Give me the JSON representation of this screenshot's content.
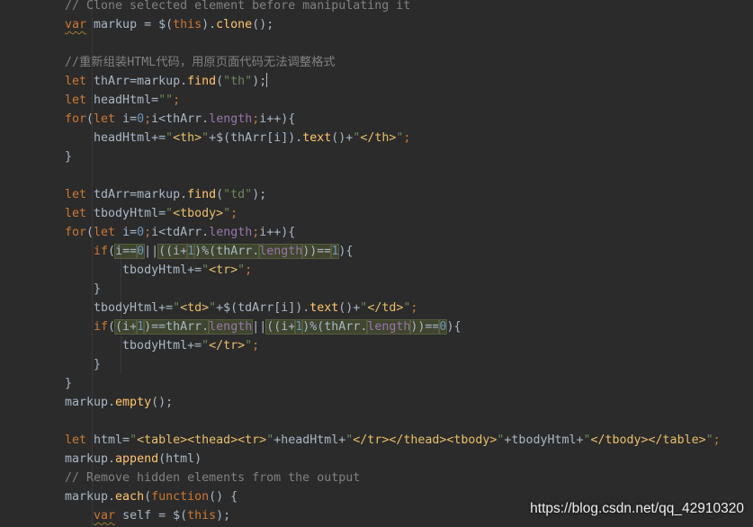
{
  "editor": {
    "lines": [
      {
        "indent": 0,
        "tokens": [
          {
            "t": "// Clone selected element before manipulating it",
            "c": "cm"
          }
        ]
      },
      {
        "indent": 0,
        "tokens": [
          {
            "t": "var",
            "c": "kw",
            "wavy": true
          },
          {
            "t": " markup = $(",
            "c": "plain"
          },
          {
            "t": "this",
            "c": "this"
          },
          {
            "t": ").",
            "c": "plain"
          },
          {
            "t": "clone",
            "c": "fn"
          },
          {
            "t": "();",
            "c": "plain"
          }
        ]
      },
      {
        "indent": 0,
        "tokens": []
      },
      {
        "indent": 0,
        "tokens": [
          {
            "t": "//重新组装HTML代码，用原页面代码无法调整格式",
            "c": "cm"
          }
        ]
      },
      {
        "indent": 0,
        "caret": true,
        "tokens": [
          {
            "t": "let",
            "c": "kw"
          },
          {
            "t": " thArr=markup.",
            "c": "plain"
          },
          {
            "t": "find",
            "c": "fn"
          },
          {
            "t": "(",
            "c": "plain"
          },
          {
            "t": "\"th\"",
            "c": "str"
          },
          {
            "t": ");",
            "c": "plain"
          }
        ]
      },
      {
        "indent": 0,
        "tokens": [
          {
            "t": "let",
            "c": "kw"
          },
          {
            "t": " headHtml=",
            "c": "plain"
          },
          {
            "t": "\"\"",
            "c": "str"
          },
          {
            "t": ";",
            "c": "kw"
          }
        ]
      },
      {
        "indent": 0,
        "tokens": [
          {
            "t": "for",
            "c": "kw"
          },
          {
            "t": "(",
            "c": "plain"
          },
          {
            "t": "let",
            "c": "kw"
          },
          {
            "t": " i=",
            "c": "plain"
          },
          {
            "t": "0",
            "c": "num"
          },
          {
            "t": ";",
            "c": "kw"
          },
          {
            "t": "i<thArr.",
            "c": "plain"
          },
          {
            "t": "length",
            "c": "prop"
          },
          {
            "t": ";",
            "c": "kw"
          },
          {
            "t": "i++){",
            "c": "plain"
          }
        ]
      },
      {
        "indent": 1,
        "tokens": [
          {
            "t": "headHtml+=",
            "c": "plain"
          },
          {
            "t": "\"",
            "c": "str"
          },
          {
            "t": "<th>",
            "c": "tag"
          },
          {
            "t": "\"",
            "c": "str"
          },
          {
            "t": "+$(thArr[i]).",
            "c": "plain"
          },
          {
            "t": "text",
            "c": "fn"
          },
          {
            "t": "()+",
            "c": "plain"
          },
          {
            "t": "\"",
            "c": "str"
          },
          {
            "t": "</th>",
            "c": "tag"
          },
          {
            "t": "\"",
            "c": "str"
          },
          {
            "t": ";",
            "c": "kw"
          }
        ]
      },
      {
        "indent": 0,
        "tokens": [
          {
            "t": "}",
            "c": "plain"
          }
        ]
      },
      {
        "indent": 0,
        "tokens": []
      },
      {
        "indent": 0,
        "tokens": [
          {
            "t": "let",
            "c": "kw"
          },
          {
            "t": " tdArr=markup.",
            "c": "plain"
          },
          {
            "t": "find",
            "c": "fn"
          },
          {
            "t": "(",
            "c": "plain"
          },
          {
            "t": "\"td\"",
            "c": "str"
          },
          {
            "t": ");",
            "c": "plain"
          }
        ]
      },
      {
        "indent": 0,
        "tokens": [
          {
            "t": "let",
            "c": "kw"
          },
          {
            "t": " tbodyHtml=",
            "c": "plain"
          },
          {
            "t": "\"",
            "c": "str"
          },
          {
            "t": "<tbody>",
            "c": "tag"
          },
          {
            "t": "\"",
            "c": "str"
          },
          {
            "t": ";",
            "c": "kw"
          }
        ]
      },
      {
        "indent": 0,
        "tokens": [
          {
            "t": "for",
            "c": "kw"
          },
          {
            "t": "(",
            "c": "plain"
          },
          {
            "t": "let",
            "c": "kw"
          },
          {
            "t": " i=",
            "c": "plain"
          },
          {
            "t": "0",
            "c": "num"
          },
          {
            "t": ";",
            "c": "kw"
          },
          {
            "t": "i<tdArr.",
            "c": "plain"
          },
          {
            "t": "length",
            "c": "prop"
          },
          {
            "t": ";",
            "c": "kw"
          },
          {
            "t": "i++){",
            "c": "plain"
          }
        ]
      },
      {
        "indent": 1,
        "tokens": [
          {
            "t": "if",
            "c": "kw"
          },
          {
            "t": "(",
            "c": "plain"
          },
          {
            "t": "i==",
            "c": "plain",
            "hl": true
          },
          {
            "t": "0",
            "c": "num",
            "hl": true
          },
          {
            "t": "||",
            "c": "plain"
          },
          {
            "t": "((i+",
            "c": "plain",
            "hl": true
          },
          {
            "t": "1",
            "c": "num",
            "hl": true
          },
          {
            "t": ")%(thArr.",
            "c": "plain",
            "hl": true
          },
          {
            "t": "length",
            "c": "prop",
            "hl": true
          },
          {
            "t": "))==",
            "c": "plain",
            "hl": true
          },
          {
            "t": "1",
            "c": "num",
            "hl": true
          },
          {
            "t": "){",
            "c": "plain"
          }
        ]
      },
      {
        "indent": 2,
        "tokens": [
          {
            "t": "tbodyHtml+=",
            "c": "plain"
          },
          {
            "t": "\"",
            "c": "str"
          },
          {
            "t": "<tr>",
            "c": "tag"
          },
          {
            "t": "\"",
            "c": "str"
          },
          {
            "t": ";",
            "c": "kw"
          }
        ]
      },
      {
        "indent": 1,
        "tokens": [
          {
            "t": "}",
            "c": "plain"
          }
        ]
      },
      {
        "indent": 1,
        "tokens": [
          {
            "t": "tbodyHtml+=",
            "c": "plain"
          },
          {
            "t": "\"",
            "c": "str"
          },
          {
            "t": "<td>",
            "c": "tag"
          },
          {
            "t": "\"",
            "c": "str"
          },
          {
            "t": "+$(tdArr[i]).",
            "c": "plain"
          },
          {
            "t": "text",
            "c": "fn"
          },
          {
            "t": "()+",
            "c": "plain"
          },
          {
            "t": "\"",
            "c": "str"
          },
          {
            "t": "</td>",
            "c": "tag"
          },
          {
            "t": "\"",
            "c": "str"
          },
          {
            "t": ";",
            "c": "kw"
          }
        ]
      },
      {
        "indent": 1,
        "tokens": [
          {
            "t": "if",
            "c": "kw"
          },
          {
            "t": "(",
            "c": "plain"
          },
          {
            "t": "(i+",
            "c": "plain",
            "hl": true
          },
          {
            "t": "1",
            "c": "num",
            "hl": true
          },
          {
            "t": ")==thArr.",
            "c": "plain",
            "hl": true
          },
          {
            "t": "length",
            "c": "prop",
            "hl": true
          },
          {
            "t": "||",
            "c": "plain"
          },
          {
            "t": "((i+",
            "c": "plain",
            "hl": true
          },
          {
            "t": "1",
            "c": "num",
            "hl": true
          },
          {
            "t": ")%(thArr.",
            "c": "plain",
            "hl": true
          },
          {
            "t": "length",
            "c": "prop",
            "hl": true
          },
          {
            "t": "))==",
            "c": "plain",
            "hl": true
          },
          {
            "t": "0",
            "c": "num",
            "hl": true
          },
          {
            "t": "){",
            "c": "plain"
          }
        ]
      },
      {
        "indent": 2,
        "tokens": [
          {
            "t": "tbodyHtml+=",
            "c": "plain"
          },
          {
            "t": "\"",
            "c": "str"
          },
          {
            "t": "</tr>",
            "c": "tag"
          },
          {
            "t": "\"",
            "c": "str"
          },
          {
            "t": ";",
            "c": "kw"
          }
        ]
      },
      {
        "indent": 1,
        "tokens": [
          {
            "t": "}",
            "c": "plain"
          }
        ]
      },
      {
        "indent": 0,
        "tokens": [
          {
            "t": "}",
            "c": "plain"
          }
        ]
      },
      {
        "indent": 0,
        "tokens": [
          {
            "t": "markup.",
            "c": "plain"
          },
          {
            "t": "empty",
            "c": "fn"
          },
          {
            "t": "();",
            "c": "plain"
          }
        ]
      },
      {
        "indent": 0,
        "tokens": []
      },
      {
        "indent": 0,
        "tokens": [
          {
            "t": "let",
            "c": "kw"
          },
          {
            "t": " html=",
            "c": "plain"
          },
          {
            "t": "\"",
            "c": "str"
          },
          {
            "t": "<table><thead><tr>",
            "c": "tag"
          },
          {
            "t": "\"",
            "c": "str"
          },
          {
            "t": "+headHtml+",
            "c": "plain"
          },
          {
            "t": "\"",
            "c": "str"
          },
          {
            "t": "</tr></thead><tbody>",
            "c": "tag"
          },
          {
            "t": "\"",
            "c": "str"
          },
          {
            "t": "+tbodyHtml+",
            "c": "plain"
          },
          {
            "t": "\"",
            "c": "str"
          },
          {
            "t": "</tbody></table>",
            "c": "tag"
          },
          {
            "t": "\"",
            "c": "str"
          },
          {
            "t": ";",
            "c": "kw"
          }
        ]
      },
      {
        "indent": 0,
        "tokens": [
          {
            "t": "markup.",
            "c": "plain"
          },
          {
            "t": "append",
            "c": "fn"
          },
          {
            "t": "(html)",
            "c": "plain"
          }
        ]
      },
      {
        "indent": 0,
        "tokens": [
          {
            "t": "// Remove hidden elements from the output",
            "c": "cm"
          }
        ]
      },
      {
        "indent": 0,
        "tokens": [
          {
            "t": "markup.",
            "c": "plain"
          },
          {
            "t": "each",
            "c": "fn"
          },
          {
            "t": "(",
            "c": "plain"
          },
          {
            "t": "function",
            "c": "kw"
          },
          {
            "t": "() {",
            "c": "plain"
          }
        ]
      },
      {
        "indent": 1,
        "tokens": [
          {
            "t": "var",
            "c": "kw",
            "wavy": true
          },
          {
            "t": " self = $(",
            "c": "plain"
          },
          {
            "t": "this",
            "c": "this"
          },
          {
            "t": ");",
            "c": "plain"
          }
        ]
      }
    ]
  },
  "watermark": "https://blog.csdn.net/qq_42910320"
}
